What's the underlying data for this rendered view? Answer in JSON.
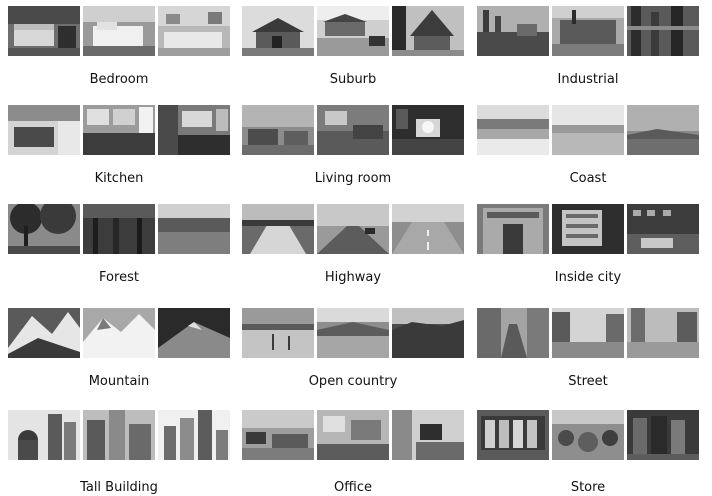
{
  "categories": [
    {
      "label": "Bedroom"
    },
    {
      "label": "Suburb"
    },
    {
      "label": "Industrial"
    },
    {
      "label": "Kitchen"
    },
    {
      "label": "Living room"
    },
    {
      "label": "Coast"
    },
    {
      "label": "Forest"
    },
    {
      "label": "Highway"
    },
    {
      "label": "Inside city"
    },
    {
      "label": "Mountain"
    },
    {
      "label": "Open country"
    },
    {
      "label": "Street"
    },
    {
      "label": "Tall Building"
    },
    {
      "label": "Office"
    },
    {
      "label": "Store"
    }
  ]
}
